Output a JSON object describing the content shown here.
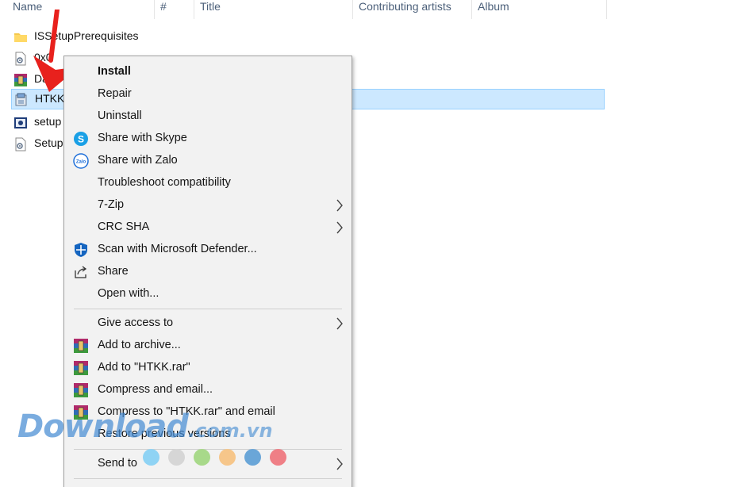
{
  "columns": {
    "name": "Name",
    "number": "#",
    "title": "Title",
    "contributing_artists": "Contributing artists",
    "album": "Album"
  },
  "files": [
    {
      "name": "ISSetupPrerequisites",
      "icon": "folder-icon",
      "selected": false
    },
    {
      "name": "0x0",
      "icon": "config-file-icon",
      "selected": false
    },
    {
      "name": "Da",
      "icon": "winrar-archive-icon",
      "selected": false
    },
    {
      "name": "HTKK",
      "icon": "installer-package-icon",
      "selected": true
    },
    {
      "name": "setup",
      "icon": "setup-app-icon",
      "selected": false
    },
    {
      "name": "Setup",
      "icon": "config-file-icon",
      "selected": false
    }
  ],
  "context_menu": {
    "items": [
      {
        "label": "Install",
        "bold": true,
        "icon": "",
        "submenu": false
      },
      {
        "label": "Repair",
        "bold": false,
        "icon": "",
        "submenu": false
      },
      {
        "label": "Uninstall",
        "bold": false,
        "icon": "",
        "submenu": false
      },
      {
        "label": "Share with Skype",
        "bold": false,
        "icon": "skype-icon",
        "submenu": false
      },
      {
        "label": "Share with Zalo",
        "bold": false,
        "icon": "zalo-icon",
        "submenu": false
      },
      {
        "label": "Troubleshoot compatibility",
        "bold": false,
        "icon": "",
        "submenu": false
      },
      {
        "label": "7-Zip",
        "bold": false,
        "icon": "",
        "submenu": true
      },
      {
        "label": "CRC SHA",
        "bold": false,
        "icon": "",
        "submenu": true
      },
      {
        "label": "Scan with Microsoft Defender...",
        "bold": false,
        "icon": "defender-shield-icon",
        "submenu": false
      },
      {
        "label": "Share",
        "bold": false,
        "icon": "share-icon",
        "submenu": false
      },
      {
        "label": "Open with...",
        "bold": false,
        "icon": "",
        "submenu": false
      },
      {
        "label": "Give access to",
        "bold": false,
        "icon": "",
        "submenu": true
      },
      {
        "label": "Add to archive...",
        "bold": false,
        "icon": "winrar-icon",
        "submenu": false
      },
      {
        "label": "Add to \"HTKK.rar\"",
        "bold": false,
        "icon": "winrar-icon",
        "submenu": false
      },
      {
        "label": "Compress and email...",
        "bold": false,
        "icon": "winrar-icon",
        "submenu": false
      },
      {
        "label": "Compress to \"HTKK.rar\" and email",
        "bold": false,
        "icon": "winrar-icon",
        "submenu": false
      },
      {
        "label": "Restore previous versions",
        "bold": false,
        "icon": "",
        "submenu": false
      },
      {
        "label": "Send to",
        "bold": false,
        "icon": "",
        "submenu": true
      }
    ]
  },
  "watermark": {
    "brand": "Download",
    "domain": ".com.vn",
    "dot_colors": [
      "#8fd3f4",
      "#d6d6d6",
      "#a8d98a",
      "#f6c68a",
      "#6aa6d8",
      "#ef7f86"
    ]
  },
  "colors": {
    "selection": "#cce8ff",
    "menu_bg": "#f2f2f2",
    "arrow": "#e8211d"
  }
}
